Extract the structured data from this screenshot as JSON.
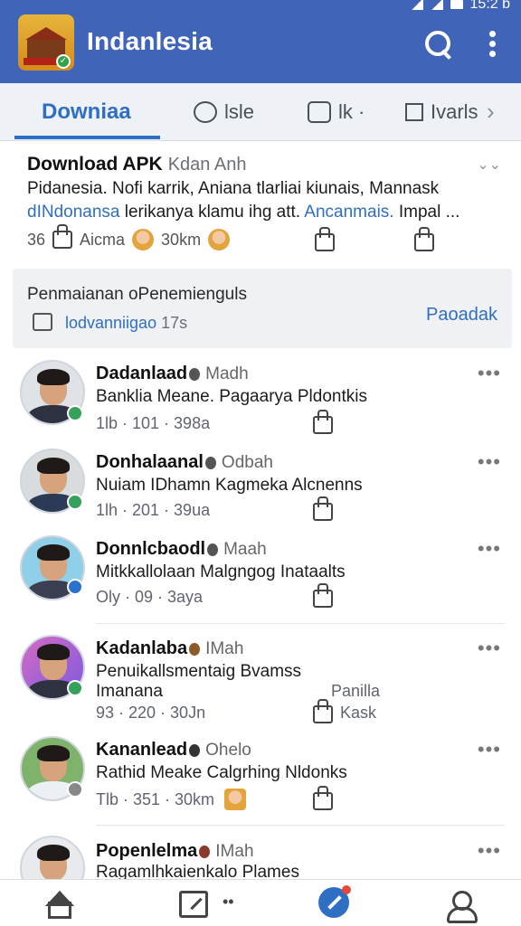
{
  "status_bar": {
    "time": "15:2 b"
  },
  "app": {
    "title": "Indanlesia"
  },
  "tabs": [
    {
      "label": "Downiaa"
    },
    {
      "label": "lsle"
    },
    {
      "label": "lk ·"
    },
    {
      "label": "Ivarls"
    }
  ],
  "post": {
    "title": "Download APK",
    "title_sub": "Kdan Anh",
    "line1": "Pidanesia. Nofi karrik, Aniana tlarliai kiunais, Mannask",
    "line2_link": "dINdonansa",
    "line2_text": " lerikanya klamu ihg att. ",
    "line2_link2": "Ancanmais.",
    "line2_tail": " Impal ...",
    "stat_likes": "36",
    "stat_label": "Aicma",
    "stat_count": "30km"
  },
  "banner": {
    "title": "Penmaianan oPenemienguls",
    "subtitle": "lodvanniigao",
    "subtitle_time": "17s",
    "action": "Paoadak"
  },
  "feed": [
    {
      "name": "Dadanlaad",
      "tag": "Madh",
      "text": "Banklia Meane. Pagaarya Pldontkis",
      "text2": "",
      "meta": "1lb · 101 · 398a",
      "like_label": ""
    },
    {
      "name": "Donhalaanal",
      "tag": "Odbah",
      "text": "Nuiam IDhamn Kagmeka Alcnenns",
      "text2": "",
      "meta": "1lh · 201 · 39ua",
      "like_label": ""
    },
    {
      "name": "Donnlcbaodl",
      "tag": "Maah",
      "text": "Mitkkallolaan Malgngog Inataalts",
      "text2": "",
      "meta": "Oly · 09 · 3aya",
      "like_label": ""
    },
    {
      "name": "Kadanlaba",
      "tag": "IMah",
      "text": "Penuikallsmentaig Bvamss",
      "text2": "Imanana",
      "meta": "93 · 220 · 30Jn",
      "like_label": "Kask",
      "side_label": "Panilla"
    },
    {
      "name": "Kananlead",
      "tag": "Ohelo",
      "text": "Rathid Meake Calgrhing Nldonks",
      "text2": "",
      "meta": "Tlb · 351 · 30km",
      "like_label": ""
    },
    {
      "name": "Popenlelma",
      "tag": "IMah",
      "text": "Ragamlhkaienkalo Plames",
      "text2": "",
      "meta": "",
      "like_label": ""
    }
  ],
  "colors": {
    "brand": "#3f64b8",
    "accent": "#2f6fc3",
    "verified": "#35a15a"
  }
}
